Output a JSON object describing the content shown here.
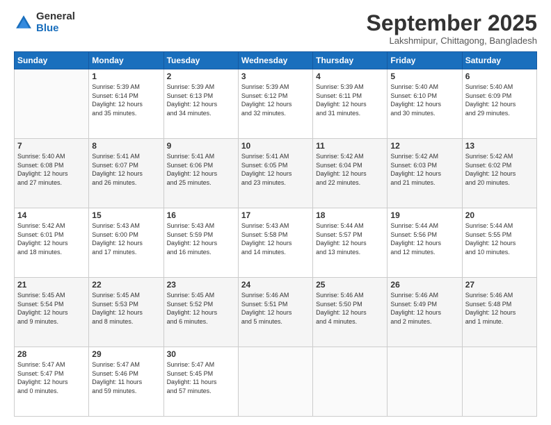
{
  "logo": {
    "general": "General",
    "blue": "Blue"
  },
  "header": {
    "month": "September 2025",
    "location": "Lakshmipur, Chittagong, Bangladesh"
  },
  "days_of_week": [
    "Sunday",
    "Monday",
    "Tuesday",
    "Wednesday",
    "Thursday",
    "Friday",
    "Saturday"
  ],
  "weeks": [
    [
      {
        "day": "",
        "info": ""
      },
      {
        "day": "1",
        "info": "Sunrise: 5:39 AM\nSunset: 6:14 PM\nDaylight: 12 hours\nand 35 minutes."
      },
      {
        "day": "2",
        "info": "Sunrise: 5:39 AM\nSunset: 6:13 PM\nDaylight: 12 hours\nand 34 minutes."
      },
      {
        "day": "3",
        "info": "Sunrise: 5:39 AM\nSunset: 6:12 PM\nDaylight: 12 hours\nand 32 minutes."
      },
      {
        "day": "4",
        "info": "Sunrise: 5:39 AM\nSunset: 6:11 PM\nDaylight: 12 hours\nand 31 minutes."
      },
      {
        "day": "5",
        "info": "Sunrise: 5:40 AM\nSunset: 6:10 PM\nDaylight: 12 hours\nand 30 minutes."
      },
      {
        "day": "6",
        "info": "Sunrise: 5:40 AM\nSunset: 6:09 PM\nDaylight: 12 hours\nand 29 minutes."
      }
    ],
    [
      {
        "day": "7",
        "info": "Sunrise: 5:40 AM\nSunset: 6:08 PM\nDaylight: 12 hours\nand 27 minutes."
      },
      {
        "day": "8",
        "info": "Sunrise: 5:41 AM\nSunset: 6:07 PM\nDaylight: 12 hours\nand 26 minutes."
      },
      {
        "day": "9",
        "info": "Sunrise: 5:41 AM\nSunset: 6:06 PM\nDaylight: 12 hours\nand 25 minutes."
      },
      {
        "day": "10",
        "info": "Sunrise: 5:41 AM\nSunset: 6:05 PM\nDaylight: 12 hours\nand 23 minutes."
      },
      {
        "day": "11",
        "info": "Sunrise: 5:42 AM\nSunset: 6:04 PM\nDaylight: 12 hours\nand 22 minutes."
      },
      {
        "day": "12",
        "info": "Sunrise: 5:42 AM\nSunset: 6:03 PM\nDaylight: 12 hours\nand 21 minutes."
      },
      {
        "day": "13",
        "info": "Sunrise: 5:42 AM\nSunset: 6:02 PM\nDaylight: 12 hours\nand 20 minutes."
      }
    ],
    [
      {
        "day": "14",
        "info": "Sunrise: 5:42 AM\nSunset: 6:01 PM\nDaylight: 12 hours\nand 18 minutes."
      },
      {
        "day": "15",
        "info": "Sunrise: 5:43 AM\nSunset: 6:00 PM\nDaylight: 12 hours\nand 17 minutes."
      },
      {
        "day": "16",
        "info": "Sunrise: 5:43 AM\nSunset: 5:59 PM\nDaylight: 12 hours\nand 16 minutes."
      },
      {
        "day": "17",
        "info": "Sunrise: 5:43 AM\nSunset: 5:58 PM\nDaylight: 12 hours\nand 14 minutes."
      },
      {
        "day": "18",
        "info": "Sunrise: 5:44 AM\nSunset: 5:57 PM\nDaylight: 12 hours\nand 13 minutes."
      },
      {
        "day": "19",
        "info": "Sunrise: 5:44 AM\nSunset: 5:56 PM\nDaylight: 12 hours\nand 12 minutes."
      },
      {
        "day": "20",
        "info": "Sunrise: 5:44 AM\nSunset: 5:55 PM\nDaylight: 12 hours\nand 10 minutes."
      }
    ],
    [
      {
        "day": "21",
        "info": "Sunrise: 5:45 AM\nSunset: 5:54 PM\nDaylight: 12 hours\nand 9 minutes."
      },
      {
        "day": "22",
        "info": "Sunrise: 5:45 AM\nSunset: 5:53 PM\nDaylight: 12 hours\nand 8 minutes."
      },
      {
        "day": "23",
        "info": "Sunrise: 5:45 AM\nSunset: 5:52 PM\nDaylight: 12 hours\nand 6 minutes."
      },
      {
        "day": "24",
        "info": "Sunrise: 5:46 AM\nSunset: 5:51 PM\nDaylight: 12 hours\nand 5 minutes."
      },
      {
        "day": "25",
        "info": "Sunrise: 5:46 AM\nSunset: 5:50 PM\nDaylight: 12 hours\nand 4 minutes."
      },
      {
        "day": "26",
        "info": "Sunrise: 5:46 AM\nSunset: 5:49 PM\nDaylight: 12 hours\nand 2 minutes."
      },
      {
        "day": "27",
        "info": "Sunrise: 5:46 AM\nSunset: 5:48 PM\nDaylight: 12 hours\nand 1 minute."
      }
    ],
    [
      {
        "day": "28",
        "info": "Sunrise: 5:47 AM\nSunset: 5:47 PM\nDaylight: 12 hours\nand 0 minutes."
      },
      {
        "day": "29",
        "info": "Sunrise: 5:47 AM\nSunset: 5:46 PM\nDaylight: 11 hours\nand 59 minutes."
      },
      {
        "day": "30",
        "info": "Sunrise: 5:47 AM\nSunset: 5:45 PM\nDaylight: 11 hours\nand 57 minutes."
      },
      {
        "day": "",
        "info": ""
      },
      {
        "day": "",
        "info": ""
      },
      {
        "day": "",
        "info": ""
      },
      {
        "day": "",
        "info": ""
      }
    ]
  ]
}
